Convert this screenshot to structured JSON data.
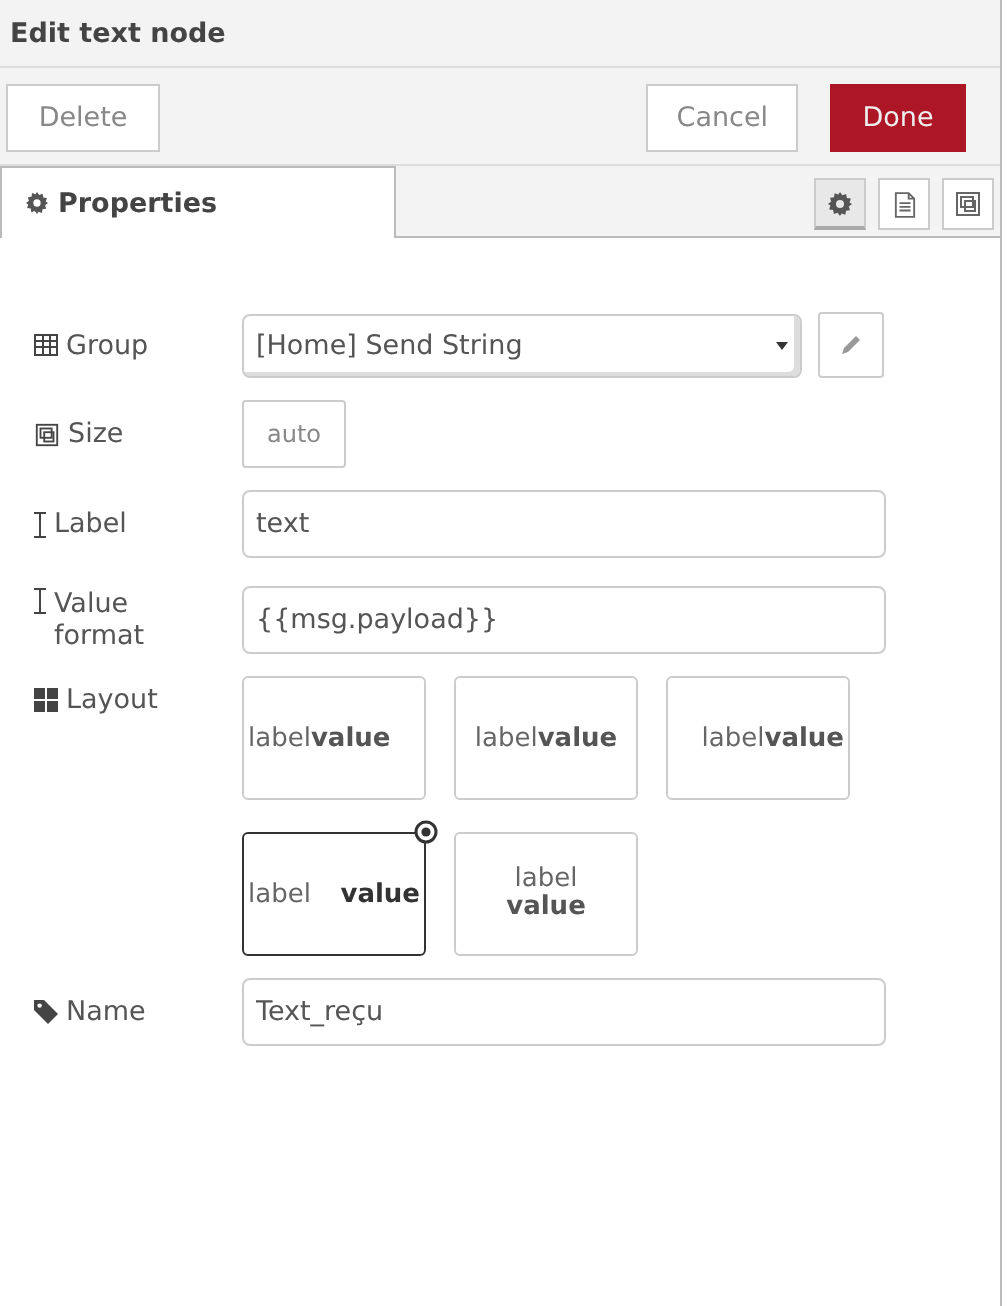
{
  "window": {
    "title": "Edit text node"
  },
  "buttons": {
    "delete": "Delete",
    "cancel": "Cancel",
    "done": "Done"
  },
  "tabs": [
    {
      "label": "Properties",
      "selected": true
    }
  ],
  "tab_icons": [
    {
      "kind": "gear",
      "selected": true
    },
    {
      "kind": "document",
      "selected": false
    },
    {
      "kind": "size",
      "selected": false
    }
  ],
  "form": {
    "group": {
      "label": "Group",
      "value": "[Home] Send String"
    },
    "size": {
      "label": "Size",
      "value": "auto"
    },
    "label": {
      "label": "Label",
      "value": "text"
    },
    "value_format": {
      "label": "Value format",
      "value": "{{msg.payload}}"
    },
    "layout": {
      "label": "Layout",
      "options": [
        {
          "kind": "left",
          "label": "label",
          "value": "value",
          "selected": false
        },
        {
          "kind": "center",
          "label": "label",
          "value": "value",
          "selected": false
        },
        {
          "kind": "right",
          "label": "label",
          "value": "value",
          "selected": false
        },
        {
          "kind": "spread",
          "label": "label",
          "value": "value",
          "selected": true
        },
        {
          "kind": "column",
          "label": "label",
          "value": "value",
          "selected": false
        }
      ]
    },
    "name": {
      "label": "Name",
      "value": "Text_reçu"
    }
  }
}
